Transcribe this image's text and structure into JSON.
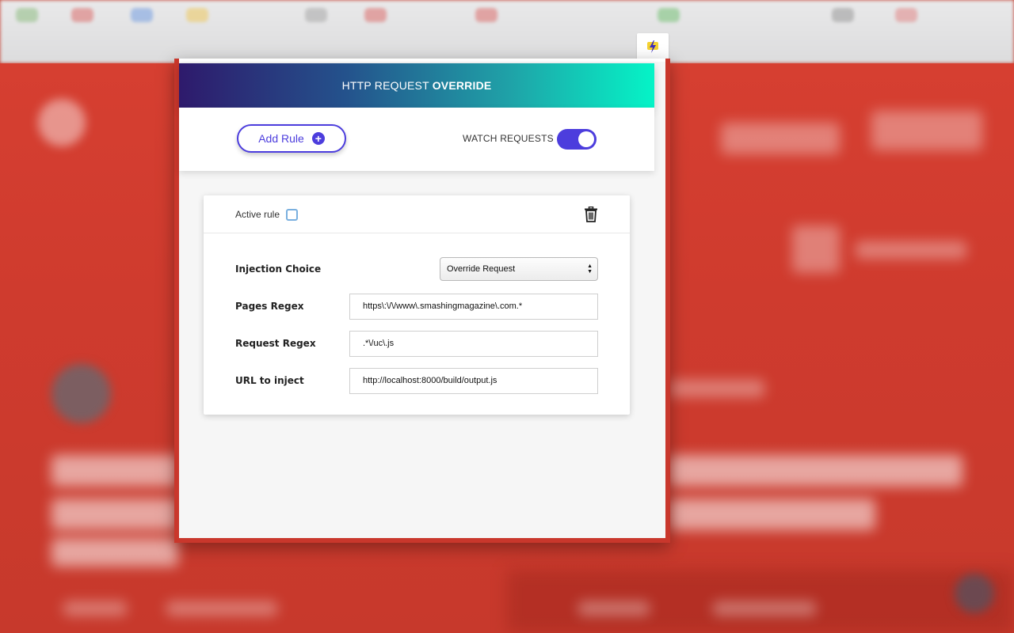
{
  "header": {
    "title_prefix": "HTTP REQUEST",
    "title_strong": "OVERRIDE"
  },
  "controls": {
    "add_rule_label": "Add Rule",
    "plus": "+",
    "watch_label": "WATCH REQUESTS",
    "watch_enabled": true
  },
  "rule": {
    "active_label": "Active rule",
    "active_checked": false,
    "fields": [
      {
        "label": "Injection Choice",
        "type": "select",
        "value": "Override Request"
      },
      {
        "label": "Pages Regex",
        "type": "input",
        "value": "https\\:\\/\\/www\\.smashingmagazine\\.com.*"
      },
      {
        "label": "Request Regex",
        "type": "input",
        "value": ".*\\/uc\\.js"
      },
      {
        "label": "URL to inject",
        "type": "input",
        "value": "http://localhost:8000/build/output.js"
      }
    ]
  },
  "colors": {
    "accent": "#4c3ddd",
    "gradient_start": "#2e1a6c",
    "gradient_end": "#05f4c7",
    "backdrop": "#d63f31"
  },
  "icons": {
    "extension": "lightning-icon",
    "delete": "trash-icon",
    "add": "plus-circle-icon"
  }
}
